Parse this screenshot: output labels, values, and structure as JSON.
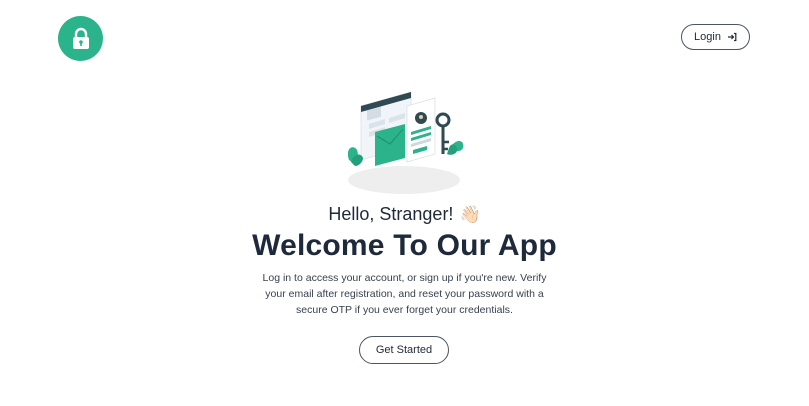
{
  "header": {
    "logo_icon": "lock-icon",
    "login_label": "Login",
    "login_icon": "sign-in-arrow-icon"
  },
  "hero": {
    "illustration": "security-key-illustration",
    "greeting": "Hello, Stranger!",
    "greeting_emoji": "👋🏻",
    "title": "Welcome To Our App",
    "description": "Log in to access your account, or sign up if you're new. Verify your email after registration, and reset your password with a secure OTP if you ever forget your credentials.",
    "cta_label": "Get Started"
  },
  "colors": {
    "accent": "#2bb38b",
    "text_dark": "#1e293b"
  }
}
